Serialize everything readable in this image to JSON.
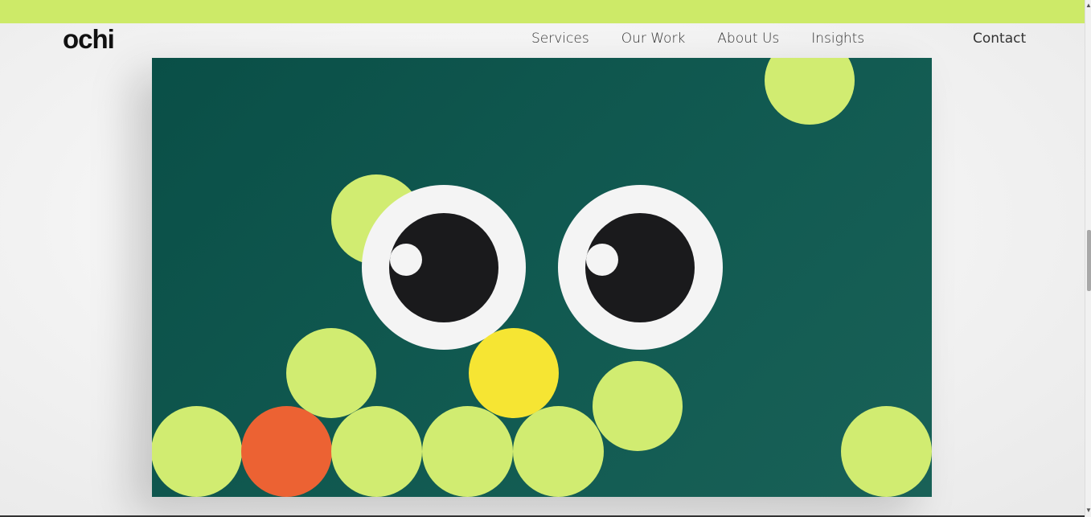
{
  "brand": {
    "logo_text": "ochi",
    "accent": "#cdea68"
  },
  "nav": {
    "items": [
      {
        "label": "Services"
      },
      {
        "label": "Our Work"
      },
      {
        "label": "About Us"
      },
      {
        "label": "Insights"
      }
    ],
    "contact_label": "Contact"
  },
  "hero": {
    "background": "#0f564d",
    "ball_colors": {
      "lime": "#d1ec71",
      "orange": "#ec6233",
      "yellow": "#f6e533"
    },
    "eye_colors": {
      "white": "#f4f4f4",
      "pupil": "#1a1a1c"
    }
  },
  "scrollbar": {
    "up_icon": "▲",
    "down_icon": "▼"
  }
}
